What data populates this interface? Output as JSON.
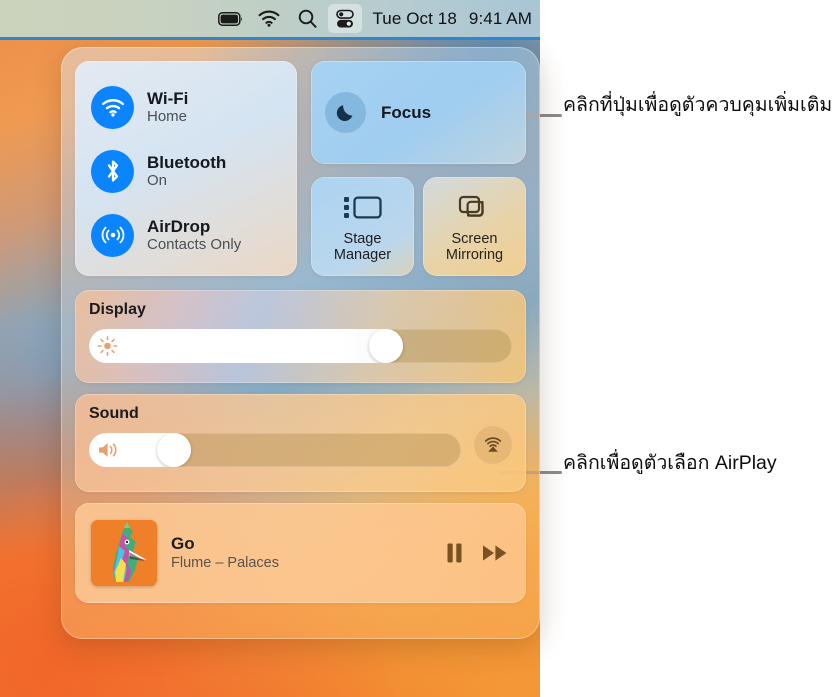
{
  "menubar": {
    "items": [
      {
        "name": "battery-icon",
        "label": "Battery"
      },
      {
        "name": "wifi-icon",
        "label": "Wi-Fi"
      },
      {
        "name": "spotlight-search-icon",
        "label": "Spotlight Search"
      },
      {
        "name": "control-center-icon",
        "label": "Control Center"
      }
    ],
    "date": "Tue Oct 18",
    "time": "9:41 AM"
  },
  "control_center": {
    "connectivity": [
      {
        "icon": "wifi-icon",
        "title": "Wi-Fi",
        "status": "Home"
      },
      {
        "icon": "bluetooth-icon",
        "title": "Bluetooth",
        "status": "On"
      },
      {
        "icon": "airdrop-icon",
        "title": "AirDrop",
        "status": "Contacts Only"
      }
    ],
    "focus": {
      "icon": "moon-icon",
      "label": "Focus"
    },
    "stage_manager": {
      "icon": "stage-manager-icon",
      "label": "Stage\nManager",
      "line1": "Stage",
      "line2": "Manager"
    },
    "screen_mirroring": {
      "icon": "screen-mirroring-icon",
      "line1": "Screen",
      "line2": "Mirroring"
    },
    "display": {
      "label": "Display",
      "icon": "brightness-icon",
      "value": 72
    },
    "sound": {
      "label": "Sound",
      "icon": "volume-icon",
      "value": 20,
      "airplay_icon": "airplay-icon"
    },
    "now_playing": {
      "title": "Go",
      "subtitle": "Flume – Palaces",
      "artwork": "album-artwork-bird",
      "pause_icon": "pause-icon",
      "next_icon": "fast-forward-icon"
    }
  },
  "annotations": [
    {
      "text": "คลิกที่ปุ่มเพื่อดูตัวควบคุมเพิ่มเติม"
    },
    {
      "text": "คลิกเพื่อดูตัวเลือก AirPlay"
    }
  ],
  "colors": {
    "accent_blue": "#0b84ff",
    "menubar_active": "rgba(255,255,255,0.40)",
    "leader_line": "#8c8c8c"
  }
}
